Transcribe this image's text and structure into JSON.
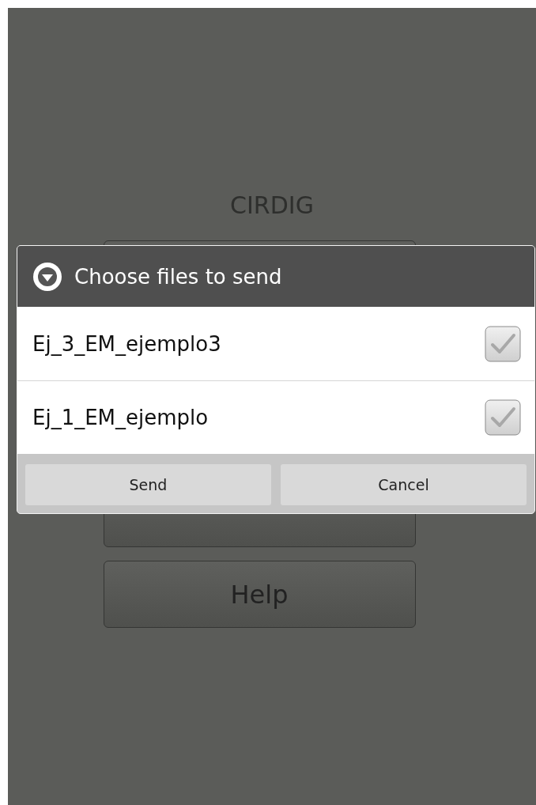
{
  "app": {
    "title": "CIRDIG",
    "buttons": [
      {
        "kind": "covered"
      },
      {
        "kind": "covered"
      },
      {
        "kind": "labeled",
        "label": "Help"
      }
    ]
  },
  "dialog": {
    "title": "Choose files to send",
    "items": [
      {
        "label": "Ej_3_EM_ejemplo3",
        "checked": true
      },
      {
        "label": "Ej_1_EM_ejemplo",
        "checked": true
      }
    ],
    "buttons": [
      "Send",
      "Cancel"
    ]
  }
}
